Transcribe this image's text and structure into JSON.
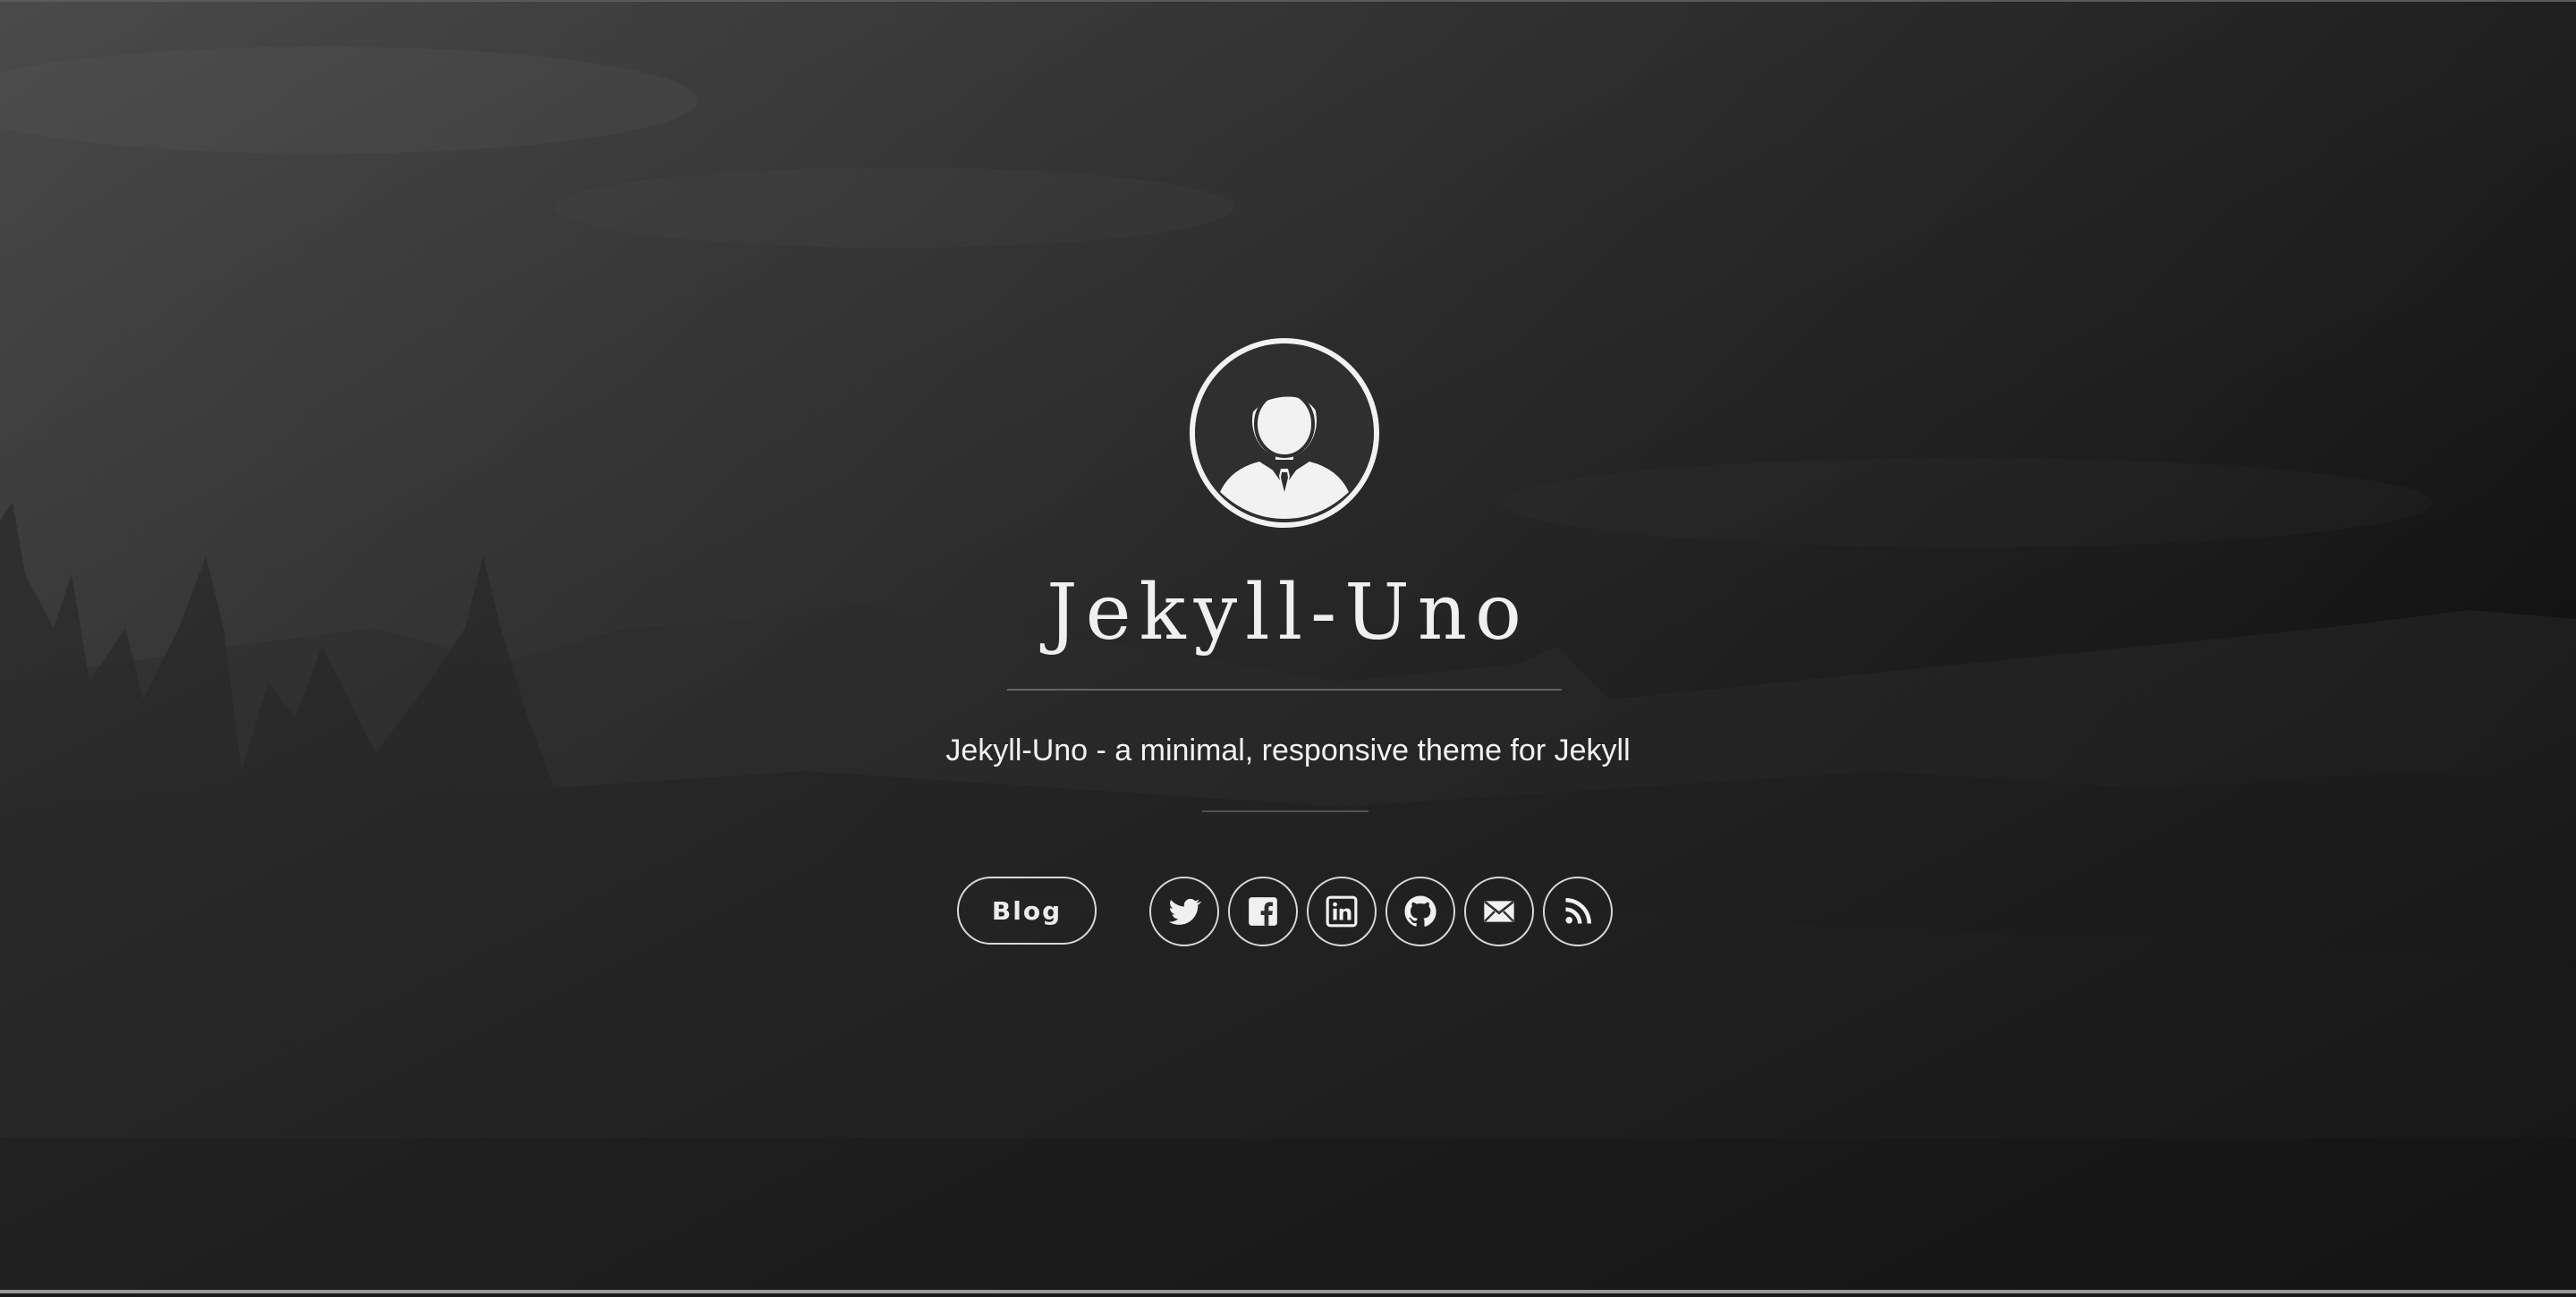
{
  "profile": {
    "avatar_icon": "user-avatar-icon",
    "title": "Jekyll-Uno",
    "subtitle": "Jekyll-Uno - a minimal, responsive theme for Jekyll"
  },
  "nav": {
    "blog_label": "Blog"
  },
  "social": [
    {
      "name": "twitter",
      "icon": "twitter-icon"
    },
    {
      "name": "facebook",
      "icon": "facebook-icon"
    },
    {
      "name": "linkedin",
      "icon": "linkedin-icon"
    },
    {
      "name": "github",
      "icon": "github-icon"
    },
    {
      "name": "email",
      "icon": "email-icon"
    },
    {
      "name": "rss",
      "icon": "rss-icon"
    }
  ],
  "colors": {
    "text": "#f0f0f0",
    "border": "#d8d8d8",
    "background_dark": "#121212",
    "background_light": "#4a4a4a"
  }
}
